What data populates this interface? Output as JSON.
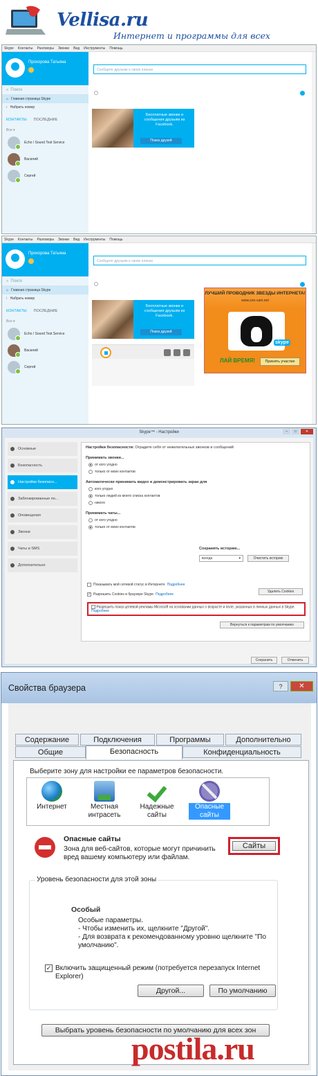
{
  "site": {
    "title": "Vellisa.ru",
    "subtitle": "Интернет и программы для всех"
  },
  "skype": {
    "menu": [
      "Skype",
      "Контакты",
      "Разговоры",
      "Звонки",
      "Вид",
      "Инструменты",
      "Помощь"
    ],
    "profile_name": "Прохорова Татьяна",
    "search_placeholder": "Поиск",
    "share_placeholder": "Сообщите друзьям о своих планах",
    "home": "Главная страница Skype",
    "dial": "Набрать номер",
    "tab_contacts": "КОНТАКТЫ",
    "tab_recent": "ПОСЛЕДНИЕ",
    "filter": "Все",
    "contacts": [
      "Echo / Sound Test Service",
      "Василий",
      "Сергей"
    ],
    "fb_text": "Бесплатные звонки и сообщения друзьям из Facebook.",
    "fb_button": "Поиск друзей"
  },
  "ad": {
    "headline": "ЛУЧШИЙ ПРОВОДНИК ЗВЕЗДЫ ИНТЕРНЕТА!",
    "url": "www.zoo-cam.net",
    "brand": "skype",
    "cta": "ЛАЙ ВРЕМЯ!",
    "button": "Принять участие"
  },
  "settings": {
    "window_title": "Skype™ - Настройки",
    "nav": [
      "Основные",
      "Безопасность",
      "Настройки безопасн...",
      "Заблокированные по...",
      "Оповещения",
      "Звонки",
      "Чаты и SMS",
      "Дополнительно"
    ],
    "heading": "Настройки безопасности:",
    "heading_desc": "Оградите себя от нежелательных звонков и сообщений",
    "calls_label": "Принимать звонки...",
    "calls_opts": [
      "от кого угодно",
      "только от моих контактов"
    ],
    "video_label": "Автоматически принимать видео и демонстрировать экран для",
    "video_opts": [
      "кого угодно",
      "только людей из моего списка контактов",
      "никого"
    ],
    "chats_label": "Принимать чаты...",
    "chats_opts": [
      "от кого угодно",
      "только от моих контактов"
    ],
    "history_label": "Сохранять историю...",
    "history_value": "всегда",
    "clear_history": "Очистить историю",
    "chk_online": "Показывать мой сетевой статус в Интернете",
    "chk_cookies": "Разрешить Cookies в браузере Skype",
    "more": "Подробнее",
    "delete_cookies": "Удалить Cookies",
    "ads_text": "Разрешить показ целевой рекламы Microsoft на основании данных о возрасте и поле, указанных в личных данных в Skype.",
    "restore": "Вернуться к параметрам по умолчанию",
    "save": "Сохранить",
    "cancel": "Отменить"
  },
  "browser": {
    "title": "Свойства браузера",
    "help": "?",
    "close": "✕",
    "tabs_row1": [
      "Содержание",
      "Подключения",
      "Программы",
      "Дополнительно"
    ],
    "tabs_row2": [
      "Общие",
      "Безопасность",
      "Конфиденциальность"
    ],
    "zone_prompt": "Выберите зону для настройки ее параметров безопасности.",
    "zones": [
      "Интернет",
      "Местная интрасеть",
      "Надежные сайты",
      "Опасные сайты"
    ],
    "zone_name": "Опасные сайты",
    "zone_desc": "Зона для веб-сайтов, которые могут причинить вред вашему компьютеру или файлам.",
    "sites_button": "Сайты",
    "level_group": "Уровень безопасности для этой зоны",
    "level_name": "Особый",
    "level_lines": [
      "Особые параметры.",
      "- Чтобы изменить их, щелкните \"Другой\".",
      "- Для возврата к рекомендованному уровню щелкните \"По умолчанию\"."
    ],
    "protected_mode": "Включить защищенный режим (потребуется перезапуск Internet Explorer)",
    "other_button": "Другой...",
    "default_button": "По умолчанию",
    "all_zones_button": "Выбрать уровень безопасности по умолчанию для всех зон"
  },
  "watermark": "postila.ru"
}
